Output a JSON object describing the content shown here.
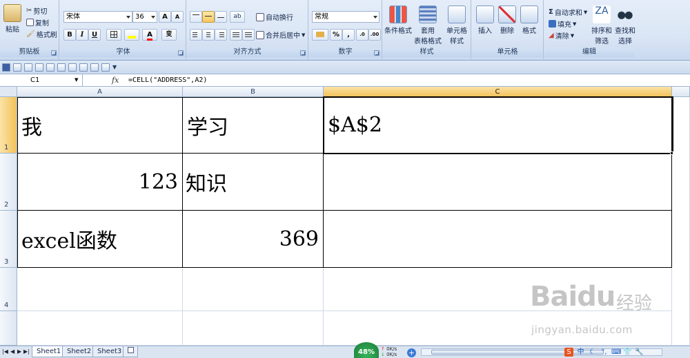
{
  "ribbon": {
    "clipboard": {
      "paste_label": "粘贴",
      "cut_label": "剪切",
      "copy_label": "复制",
      "format_painter_label": "格式刷",
      "group_label": "剪贴板"
    },
    "font": {
      "font_name": "宋体",
      "font_size": "36",
      "grow_label": "A",
      "shrink_label": "A",
      "bold_label": "B",
      "italic_label": "I",
      "underline_label": "U",
      "phonetic_label": "变",
      "group_label": "字体"
    },
    "alignment": {
      "wrap_label": "自动换行",
      "merge_label": "合并后居中",
      "group_label": "对齐方式"
    },
    "number": {
      "format_value": "常规",
      "percent_label": "%",
      "comma_label": ",",
      "group_label": "数字"
    },
    "styles": {
      "conditional_label": "条件格式",
      "table_label_1": "套用",
      "table_label_2": "表格格式",
      "cell_style_label_1": "单元格",
      "cell_style_label_2": "样式",
      "group_label": "样式"
    },
    "cells": {
      "insert_label": "插入",
      "delete_label": "删除",
      "format_label": "格式",
      "group_label": "单元格"
    },
    "editing": {
      "autosum_label": "自动求和",
      "fill_label": "填充",
      "clear_label": "清除",
      "sort_label_1": "排序和",
      "sort_label_2": "筛选",
      "find_label_1": "查找和",
      "find_label_2": "选择",
      "group_label": "编辑"
    }
  },
  "formula_bar": {
    "name_box": "C1",
    "fx_label": "fx",
    "formula": "=CELL(\"ADDRESS\",A2)"
  },
  "grid": {
    "columns": [
      "A",
      "B",
      "C"
    ],
    "rows": [
      "1",
      "2",
      "3",
      "4"
    ],
    "cells": {
      "A1": "我",
      "B1": "学习",
      "C1": "$A$2",
      "A2": "123",
      "B2": "知识",
      "A3": "excel函数",
      "B3": "369"
    }
  },
  "sheets": [
    "Sheet1",
    "Sheet2",
    "Sheet3"
  ],
  "status": {
    "speed_percent": "48%",
    "upload": "0K/s",
    "download": "0K/s"
  },
  "watermark": {
    "logo": "Baidu",
    "cn": "经验",
    "url": "jingyan.baidu.com"
  },
  "colors": {
    "ribbon_bg": "#dbe6f5",
    "selected_header": "#f2c25b",
    "sheet_active": "#ffffff"
  }
}
